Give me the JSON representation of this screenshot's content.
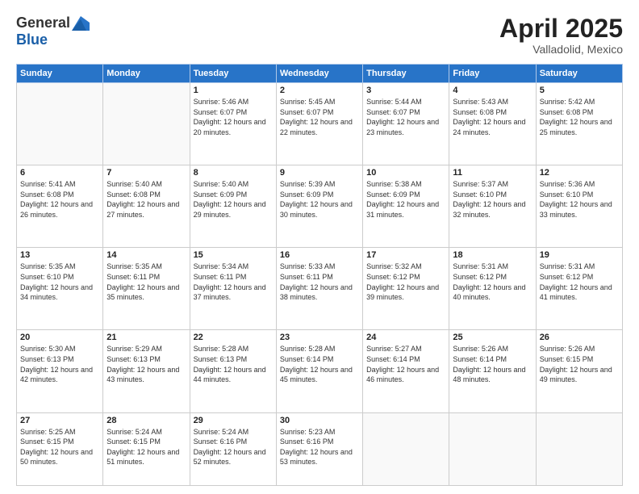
{
  "header": {
    "logo_general": "General",
    "logo_blue": "Blue",
    "month_title": "April 2025",
    "location": "Valladolid, Mexico"
  },
  "weekdays": [
    "Sunday",
    "Monday",
    "Tuesday",
    "Wednesday",
    "Thursday",
    "Friday",
    "Saturday"
  ],
  "weeks": [
    [
      {
        "day": "",
        "sunrise": "",
        "sunset": "",
        "daylight": ""
      },
      {
        "day": "",
        "sunrise": "",
        "sunset": "",
        "daylight": ""
      },
      {
        "day": "1",
        "sunrise": "Sunrise: 5:46 AM",
        "sunset": "Sunset: 6:07 PM",
        "daylight": "Daylight: 12 hours and 20 minutes."
      },
      {
        "day": "2",
        "sunrise": "Sunrise: 5:45 AM",
        "sunset": "Sunset: 6:07 PM",
        "daylight": "Daylight: 12 hours and 22 minutes."
      },
      {
        "day": "3",
        "sunrise": "Sunrise: 5:44 AM",
        "sunset": "Sunset: 6:07 PM",
        "daylight": "Daylight: 12 hours and 23 minutes."
      },
      {
        "day": "4",
        "sunrise": "Sunrise: 5:43 AM",
        "sunset": "Sunset: 6:08 PM",
        "daylight": "Daylight: 12 hours and 24 minutes."
      },
      {
        "day": "5",
        "sunrise": "Sunrise: 5:42 AM",
        "sunset": "Sunset: 6:08 PM",
        "daylight": "Daylight: 12 hours and 25 minutes."
      }
    ],
    [
      {
        "day": "6",
        "sunrise": "Sunrise: 5:41 AM",
        "sunset": "Sunset: 6:08 PM",
        "daylight": "Daylight: 12 hours and 26 minutes."
      },
      {
        "day": "7",
        "sunrise": "Sunrise: 5:40 AM",
        "sunset": "Sunset: 6:08 PM",
        "daylight": "Daylight: 12 hours and 27 minutes."
      },
      {
        "day": "8",
        "sunrise": "Sunrise: 5:40 AM",
        "sunset": "Sunset: 6:09 PM",
        "daylight": "Daylight: 12 hours and 29 minutes."
      },
      {
        "day": "9",
        "sunrise": "Sunrise: 5:39 AM",
        "sunset": "Sunset: 6:09 PM",
        "daylight": "Daylight: 12 hours and 30 minutes."
      },
      {
        "day": "10",
        "sunrise": "Sunrise: 5:38 AM",
        "sunset": "Sunset: 6:09 PM",
        "daylight": "Daylight: 12 hours and 31 minutes."
      },
      {
        "day": "11",
        "sunrise": "Sunrise: 5:37 AM",
        "sunset": "Sunset: 6:10 PM",
        "daylight": "Daylight: 12 hours and 32 minutes."
      },
      {
        "day": "12",
        "sunrise": "Sunrise: 5:36 AM",
        "sunset": "Sunset: 6:10 PM",
        "daylight": "Daylight: 12 hours and 33 minutes."
      }
    ],
    [
      {
        "day": "13",
        "sunrise": "Sunrise: 5:35 AM",
        "sunset": "Sunset: 6:10 PM",
        "daylight": "Daylight: 12 hours and 34 minutes."
      },
      {
        "day": "14",
        "sunrise": "Sunrise: 5:35 AM",
        "sunset": "Sunset: 6:11 PM",
        "daylight": "Daylight: 12 hours and 35 minutes."
      },
      {
        "day": "15",
        "sunrise": "Sunrise: 5:34 AM",
        "sunset": "Sunset: 6:11 PM",
        "daylight": "Daylight: 12 hours and 37 minutes."
      },
      {
        "day": "16",
        "sunrise": "Sunrise: 5:33 AM",
        "sunset": "Sunset: 6:11 PM",
        "daylight": "Daylight: 12 hours and 38 minutes."
      },
      {
        "day": "17",
        "sunrise": "Sunrise: 5:32 AM",
        "sunset": "Sunset: 6:12 PM",
        "daylight": "Daylight: 12 hours and 39 minutes."
      },
      {
        "day": "18",
        "sunrise": "Sunrise: 5:31 AM",
        "sunset": "Sunset: 6:12 PM",
        "daylight": "Daylight: 12 hours and 40 minutes."
      },
      {
        "day": "19",
        "sunrise": "Sunrise: 5:31 AM",
        "sunset": "Sunset: 6:12 PM",
        "daylight": "Daylight: 12 hours and 41 minutes."
      }
    ],
    [
      {
        "day": "20",
        "sunrise": "Sunrise: 5:30 AM",
        "sunset": "Sunset: 6:13 PM",
        "daylight": "Daylight: 12 hours and 42 minutes."
      },
      {
        "day": "21",
        "sunrise": "Sunrise: 5:29 AM",
        "sunset": "Sunset: 6:13 PM",
        "daylight": "Daylight: 12 hours and 43 minutes."
      },
      {
        "day": "22",
        "sunrise": "Sunrise: 5:28 AM",
        "sunset": "Sunset: 6:13 PM",
        "daylight": "Daylight: 12 hours and 44 minutes."
      },
      {
        "day": "23",
        "sunrise": "Sunrise: 5:28 AM",
        "sunset": "Sunset: 6:14 PM",
        "daylight": "Daylight: 12 hours and 45 minutes."
      },
      {
        "day": "24",
        "sunrise": "Sunrise: 5:27 AM",
        "sunset": "Sunset: 6:14 PM",
        "daylight": "Daylight: 12 hours and 46 minutes."
      },
      {
        "day": "25",
        "sunrise": "Sunrise: 5:26 AM",
        "sunset": "Sunset: 6:14 PM",
        "daylight": "Daylight: 12 hours and 48 minutes."
      },
      {
        "day": "26",
        "sunrise": "Sunrise: 5:26 AM",
        "sunset": "Sunset: 6:15 PM",
        "daylight": "Daylight: 12 hours and 49 minutes."
      }
    ],
    [
      {
        "day": "27",
        "sunrise": "Sunrise: 5:25 AM",
        "sunset": "Sunset: 6:15 PM",
        "daylight": "Daylight: 12 hours and 50 minutes."
      },
      {
        "day": "28",
        "sunrise": "Sunrise: 5:24 AM",
        "sunset": "Sunset: 6:15 PM",
        "daylight": "Daylight: 12 hours and 51 minutes."
      },
      {
        "day": "29",
        "sunrise": "Sunrise: 5:24 AM",
        "sunset": "Sunset: 6:16 PM",
        "daylight": "Daylight: 12 hours and 52 minutes."
      },
      {
        "day": "30",
        "sunrise": "Sunrise: 5:23 AM",
        "sunset": "Sunset: 6:16 PM",
        "daylight": "Daylight: 12 hours and 53 minutes."
      },
      {
        "day": "",
        "sunrise": "",
        "sunset": "",
        "daylight": ""
      },
      {
        "day": "",
        "sunrise": "",
        "sunset": "",
        "daylight": ""
      },
      {
        "day": "",
        "sunrise": "",
        "sunset": "",
        "daylight": ""
      }
    ]
  ]
}
